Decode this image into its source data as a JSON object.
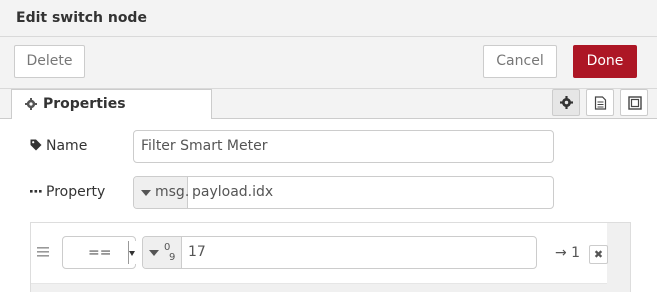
{
  "dialog": {
    "title": "Edit switch node"
  },
  "toolbar": {
    "delete_label": "Delete",
    "cancel_label": "Cancel",
    "done_label": "Done"
  },
  "tabs": {
    "properties_label": "Properties"
  },
  "form": {
    "name_label": "Name",
    "name_value": "Filter Smart Meter",
    "property_label": "Property",
    "property_prefix": "msg.",
    "property_value": "payload.idx"
  },
  "rule": {
    "operator": "==",
    "value_type_glyph_top": "0",
    "value_type_glyph_bottom": "9",
    "value": "17",
    "output": "→ 1",
    "remove_glyph": "✖"
  },
  "colors": {
    "done_button": "#ad1625",
    "toolbar_bg": "#f3f3f3"
  },
  "icons": [
    "cog-icon",
    "tag-icon",
    "ellipsis-icon",
    "file-text-icon",
    "window-maximize-icon",
    "bars-icon",
    "caret-down-icon",
    "number-type-icon",
    "close-icon"
  ]
}
